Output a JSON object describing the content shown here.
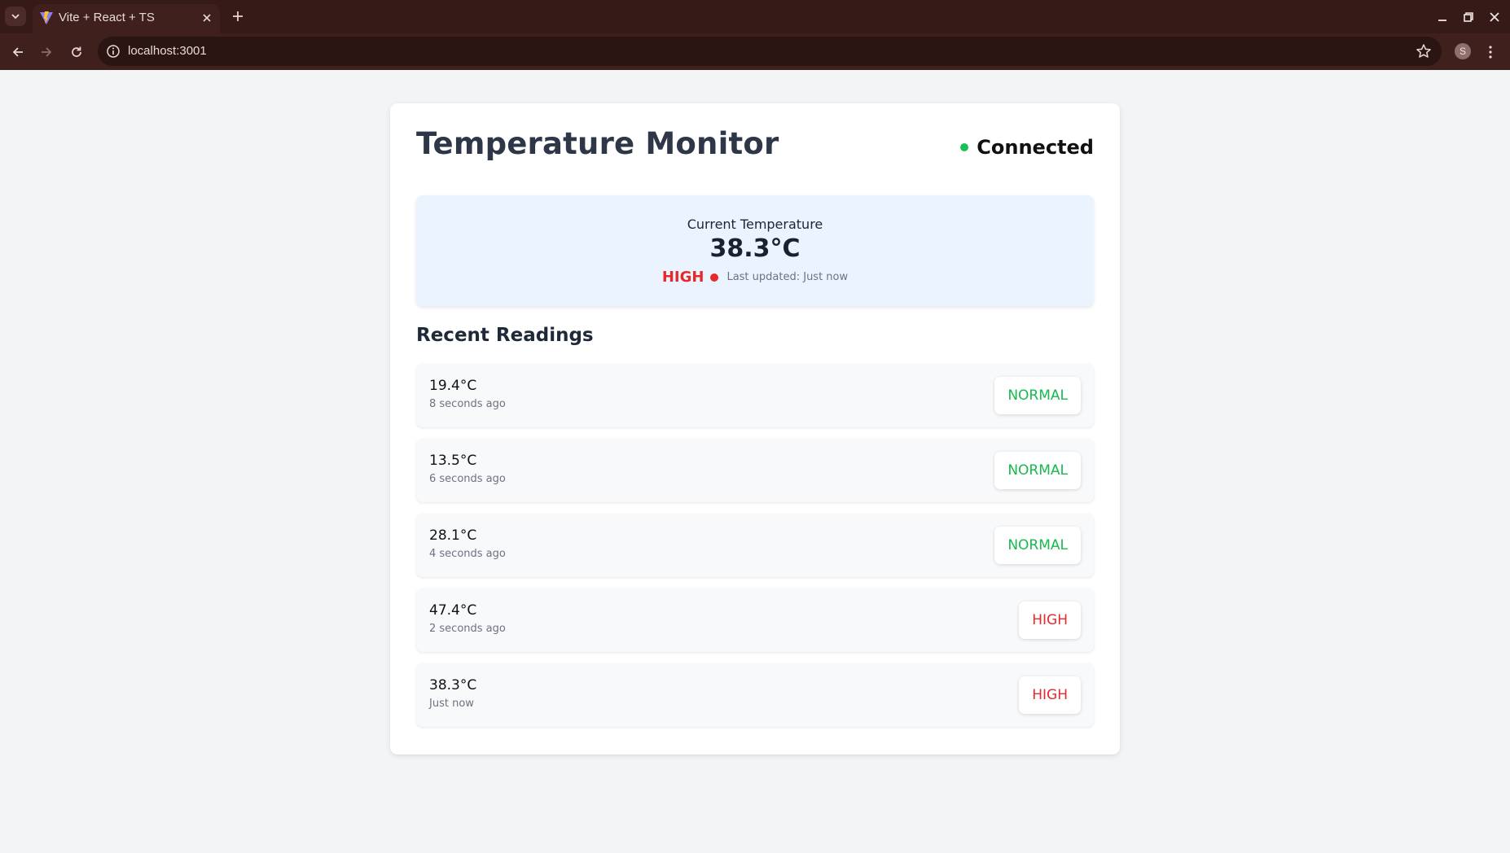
{
  "browser": {
    "tab_title": "Vite + React + TS",
    "url": "localhost:3001",
    "profile_initial": "S"
  },
  "app": {
    "title": "Temperature Monitor",
    "connection_status": "Connected",
    "current": {
      "label": "Current Temperature",
      "value": "38.3°C",
      "status": "HIGH",
      "last_updated": "Last updated: Just now"
    },
    "recent_title": "Recent Readings",
    "readings": [
      {
        "temp": "19.4°C",
        "time": "8 seconds ago",
        "status": "NORMAL"
      },
      {
        "temp": "13.5°C",
        "time": "6 seconds ago",
        "status": "NORMAL"
      },
      {
        "temp": "28.1°C",
        "time": "4 seconds ago",
        "status": "NORMAL"
      },
      {
        "temp": "47.4°C",
        "time": "2 seconds ago",
        "status": "HIGH"
      },
      {
        "temp": "38.3°C",
        "time": "Just now",
        "status": "HIGH"
      }
    ]
  },
  "colors": {
    "high": "#e5292d",
    "normal": "#18b94f",
    "connected": "#16c15b",
    "chrome": "#3f201d"
  },
  "icons": [
    "tab-list-icon",
    "vite-favicon-icon",
    "close-icon",
    "plus-icon",
    "minimize-icon",
    "restore-icon",
    "back-arrow-icon",
    "forward-arrow-icon",
    "reload-icon",
    "info-icon",
    "star-icon",
    "kebab-menu-icon"
  ]
}
